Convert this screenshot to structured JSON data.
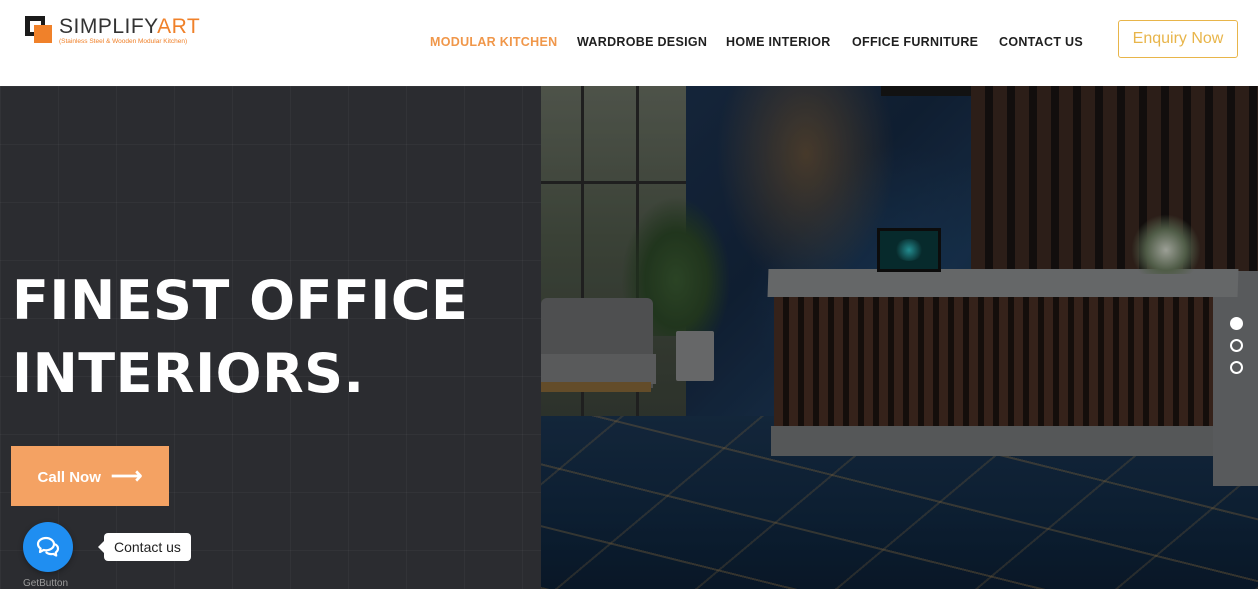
{
  "brand": {
    "name_main": "SIMPLIFY",
    "name_accent": "ART",
    "tagline": "(Stainless Steel & Wooden Modular Kitchen)",
    "accent_color": "#f0812a"
  },
  "nav": {
    "items": [
      {
        "label": "MODULAR KITCHEN",
        "active": true
      },
      {
        "label": "WARDROBE DESIGN",
        "active": false
      },
      {
        "label": "HOME INTERIOR",
        "active": false
      },
      {
        "label": "OFFICE FURNITURE",
        "active": false
      },
      {
        "label": "CONTACT US",
        "active": false
      }
    ],
    "active_color": "#f0974a",
    "enquiry_label": "Enquiry Now",
    "enquiry_color": "#e8b54a"
  },
  "hero": {
    "title_line1": "FINEST OFFICE",
    "title_line2": "INTERIORS.",
    "cta_label": "Call Now",
    "cta_icon": "long-arrow-right-icon",
    "cta_color": "#f4a263",
    "image_subject": "office-reception-interior",
    "slides_total": 3,
    "slide_active": 1
  },
  "widget": {
    "tooltip": "Contact us",
    "icon": "chat-bubbles-icon",
    "credit": "GetButton",
    "button_color": "#1f8ef1"
  }
}
